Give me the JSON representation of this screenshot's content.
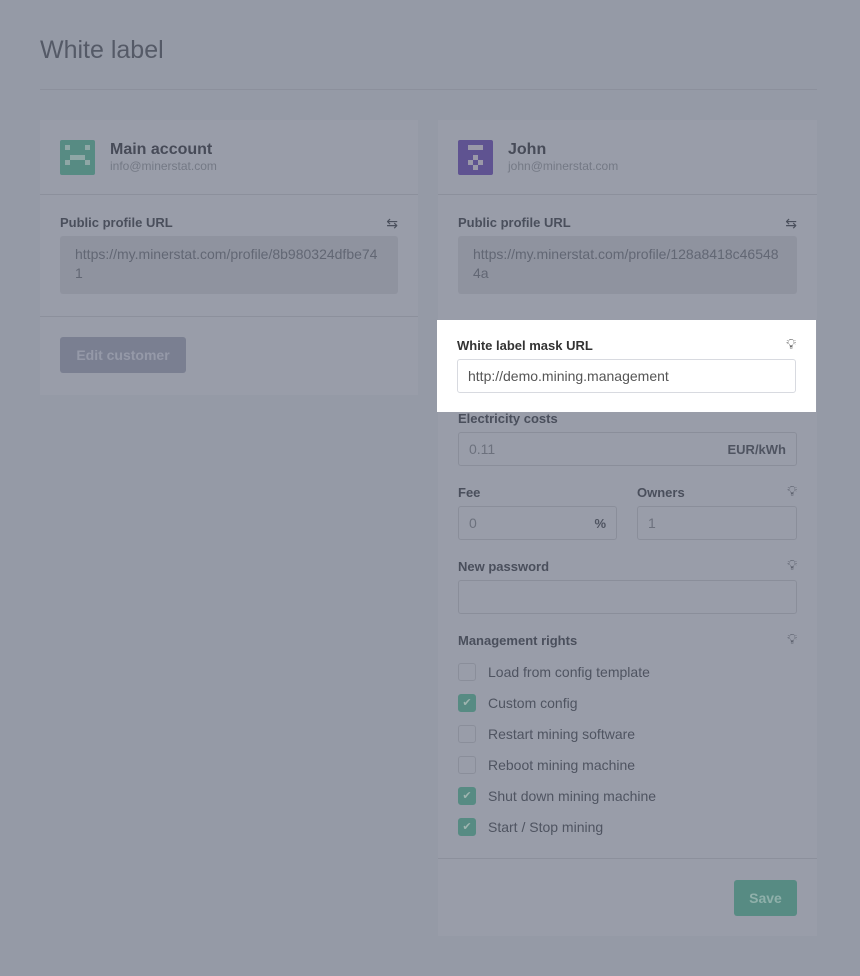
{
  "page": {
    "title": "White label"
  },
  "main_account": {
    "name": "Main account",
    "email": "info@minerstat.com",
    "profile_label": "Public profile URL",
    "profile_url": "https://my.minerstat.com/profile/8b980324dfbe741",
    "edit_button": "Edit customer",
    "avatar_color": "#578b83"
  },
  "john": {
    "name": "John",
    "email": "john@minerstat.com",
    "profile_label": "Public profile URL",
    "profile_url": "https://my.minerstat.com/profile/128a8418c465484a",
    "avatar_color": "#5f5391",
    "mask_label": "White label mask URL",
    "mask_value": "http://demo.mining.management",
    "electricity_label": "Electricity costs",
    "electricity_value": "0.11",
    "electricity_unit": "EUR/kWh",
    "fee_label": "Fee",
    "fee_value": "0",
    "fee_unit": "%",
    "owners_label": "Owners",
    "owners_value": "1",
    "password_label": "New password",
    "password_value": "",
    "rights_label": "Management rights",
    "rights": [
      {
        "label": "Load from config template",
        "checked": false
      },
      {
        "label": "Custom config",
        "checked": true
      },
      {
        "label": "Restart mining software",
        "checked": false
      },
      {
        "label": "Reboot mining machine",
        "checked": false
      },
      {
        "label": "Shut down mining machine",
        "checked": true
      },
      {
        "label": "Start / Stop mining",
        "checked": true
      }
    ],
    "save_button": "Save"
  }
}
